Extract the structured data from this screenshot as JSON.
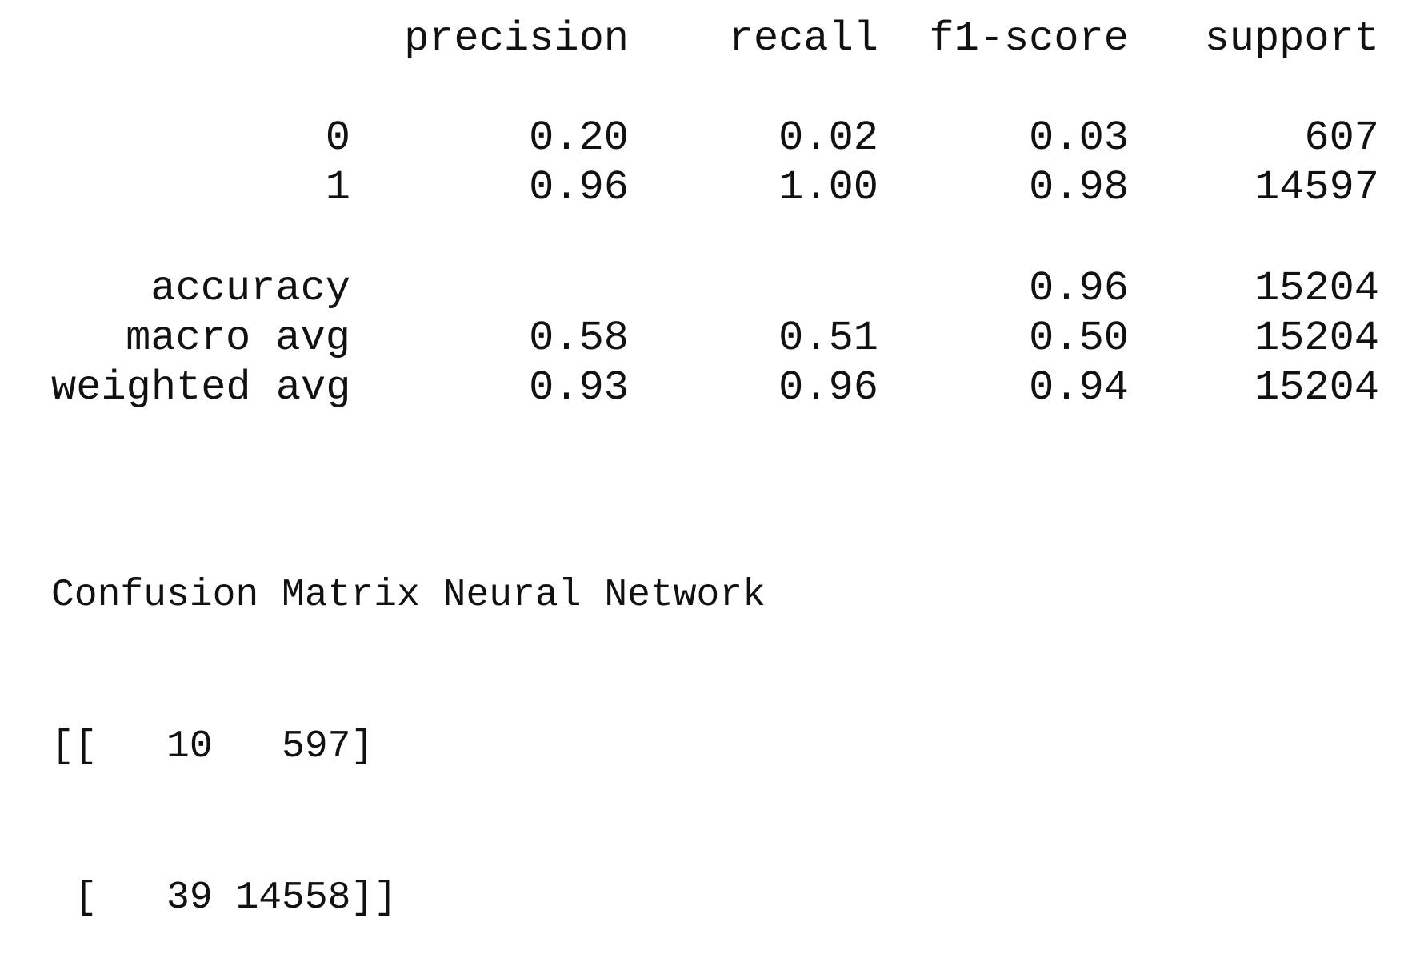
{
  "report": {
    "headers": {
      "label": "",
      "precision": "precision",
      "recall": "recall",
      "f1": "f1-score",
      "support": "support"
    },
    "class_rows": [
      {
        "label": "0",
        "precision": "0.20",
        "recall": "0.02",
        "f1": "0.03",
        "support": "607"
      },
      {
        "label": "1",
        "precision": "0.96",
        "recall": "1.00",
        "f1": "0.98",
        "support": "14597"
      }
    ],
    "summary_rows": [
      {
        "label": "accuracy",
        "precision": "",
        "recall": "",
        "f1": "0.96",
        "support": "15204"
      },
      {
        "label": "macro avg",
        "precision": "0.58",
        "recall": "0.51",
        "f1": "0.50",
        "support": "15204"
      },
      {
        "label": "weighted avg",
        "precision": "0.93",
        "recall": "0.96",
        "f1": "0.94",
        "support": "15204"
      }
    ]
  },
  "confusion_matrix": {
    "title": "Confusion Matrix Neural Network",
    "lines": [
      "[[   10   597]",
      " [   39 14558]]"
    ]
  }
}
